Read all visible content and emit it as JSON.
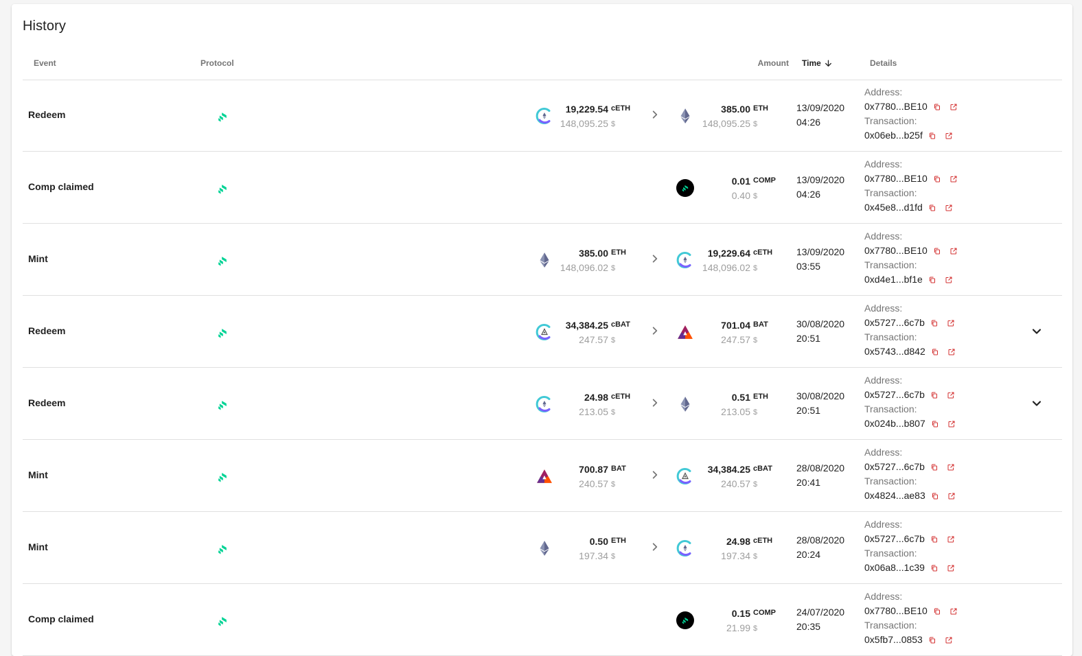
{
  "card": {
    "title": "History"
  },
  "header": {
    "event": "Event",
    "protocol": "Protocol",
    "amount": "Amount",
    "time": "Time",
    "details": "Details"
  },
  "labels": {
    "address": "Address:",
    "transaction": "Transaction:"
  },
  "colors": {
    "compound_green": "#00d395",
    "eth_purple": "#627eea",
    "bat_orange": "#ff5000",
    "header_text": "#757575",
    "muted_text": "#9e9e9e",
    "divider": "#e0e0e0"
  },
  "rows": [
    {
      "event": "Redeem",
      "from": {
        "icon": "ceth-icon",
        "value": "19,229.54",
        "symbol": "cETH",
        "usd": "148,095.25",
        "usd_symbol": "$"
      },
      "to": {
        "icon": "eth-icon",
        "value": "385.00",
        "symbol": "ETH",
        "usd": "148,095.25",
        "usd_symbol": "$"
      },
      "date": "13/09/2020",
      "time": "04:26",
      "address": "0x7780...BE10",
      "transaction": "0x06eb...b25f",
      "expandable": false
    },
    {
      "event": "Comp claimed",
      "from": null,
      "to": {
        "icon": "comp-icon",
        "value": "0.01",
        "symbol": "COMP",
        "usd": "0.40",
        "usd_symbol": "$"
      },
      "date": "13/09/2020",
      "time": "04:26",
      "address": "0x7780...BE10",
      "transaction": "0x45e8...d1fd",
      "expandable": false
    },
    {
      "event": "Mint",
      "from": {
        "icon": "eth-icon",
        "value": "385.00",
        "symbol": "ETH",
        "usd": "148,096.02",
        "usd_symbol": "$"
      },
      "to": {
        "icon": "ceth-icon",
        "value": "19,229.64",
        "symbol": "cETH",
        "usd": "148,096.02",
        "usd_symbol": "$"
      },
      "date": "13/09/2020",
      "time": "03:55",
      "address": "0x7780...BE10",
      "transaction": "0xd4e1...bf1e",
      "expandable": false
    },
    {
      "event": "Redeem",
      "from": {
        "icon": "cbat-icon",
        "value": "34,384.25",
        "symbol": "cBAT",
        "usd": "247.57",
        "usd_symbol": "$"
      },
      "to": {
        "icon": "bat-icon",
        "value": "701.04",
        "symbol": "BAT",
        "usd": "247.57",
        "usd_symbol": "$"
      },
      "date": "30/08/2020",
      "time": "20:51",
      "address": "0x5727...6c7b",
      "transaction": "0x5743...d842",
      "expandable": true
    },
    {
      "event": "Redeem",
      "from": {
        "icon": "ceth-icon",
        "value": "24.98",
        "symbol": "cETH",
        "usd": "213.05",
        "usd_symbol": "$"
      },
      "to": {
        "icon": "eth-icon",
        "value": "0.51",
        "symbol": "ETH",
        "usd": "213.05",
        "usd_symbol": "$"
      },
      "date": "30/08/2020",
      "time": "20:51",
      "address": "0x5727...6c7b",
      "transaction": "0x024b...b807",
      "expandable": true
    },
    {
      "event": "Mint",
      "from": {
        "icon": "bat-icon",
        "value": "700.87",
        "symbol": "BAT",
        "usd": "240.57",
        "usd_symbol": "$"
      },
      "to": {
        "icon": "cbat-icon",
        "value": "34,384.25",
        "symbol": "cBAT",
        "usd": "240.57",
        "usd_symbol": "$"
      },
      "date": "28/08/2020",
      "time": "20:41",
      "address": "0x5727...6c7b",
      "transaction": "0x4824...ae83",
      "expandable": false
    },
    {
      "event": "Mint",
      "from": {
        "icon": "eth-icon",
        "value": "0.50",
        "symbol": "ETH",
        "usd": "197.34",
        "usd_symbol": "$"
      },
      "to": {
        "icon": "ceth-icon",
        "value": "24.98",
        "symbol": "cETH",
        "usd": "197.34",
        "usd_symbol": "$"
      },
      "date": "28/08/2020",
      "time": "20:24",
      "address": "0x5727...6c7b",
      "transaction": "0x06a8...1c39",
      "expandable": false
    },
    {
      "event": "Comp claimed",
      "from": null,
      "to": {
        "icon": "comp-icon",
        "value": "0.15",
        "symbol": "COMP",
        "usd": "21.99",
        "usd_symbol": "$"
      },
      "date": "24/07/2020",
      "time": "20:35",
      "address": "0x7780...BE10",
      "transaction": "0x5fb7...0853",
      "expandable": false
    }
  ]
}
